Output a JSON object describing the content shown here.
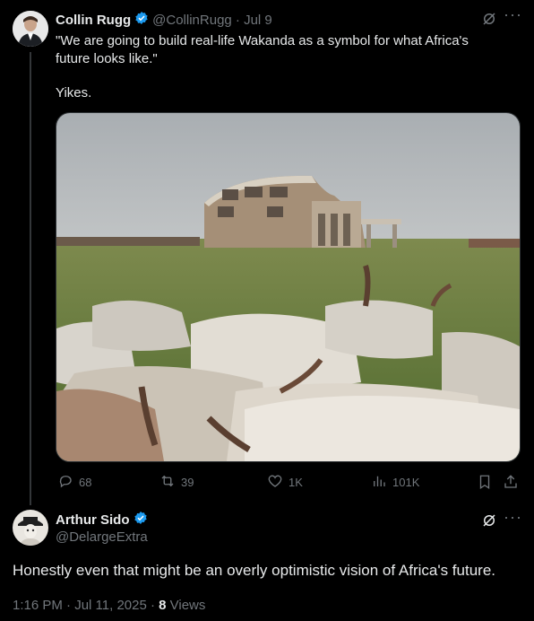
{
  "tweet": {
    "author_name": "Collin Rugg",
    "handle_date": "@CollinRugg · Jul 9",
    "body_line1": "\"We are going to build real-life Wakanda as a symbol for what Africa's",
    "body_line2": "future looks like.\"",
    "body_line3": "Yikes.",
    "actions": {
      "replies": "68",
      "reposts": "39",
      "likes": "1K",
      "views": "101K"
    }
  },
  "reply": {
    "author_name": "Arthur Sido",
    "handle": "@DelargeExtra",
    "body": "Honestly even that might be an overly optimistic vision of Africa's future.",
    "timestamp": "1:16 PM · Jul 11, 2025 · ",
    "views_count": "8",
    "views_label": " Views"
  },
  "colors": {
    "background": "#000000",
    "text": "#e7e9ea",
    "muted": "#71767b",
    "verified": "#1d9bf0"
  },
  "icons": [
    "grok-icon",
    "more-icon",
    "reply-icon",
    "repost-icon",
    "like-icon",
    "views-icon",
    "bookmark-icon",
    "share-icon",
    "verified-icon"
  ]
}
